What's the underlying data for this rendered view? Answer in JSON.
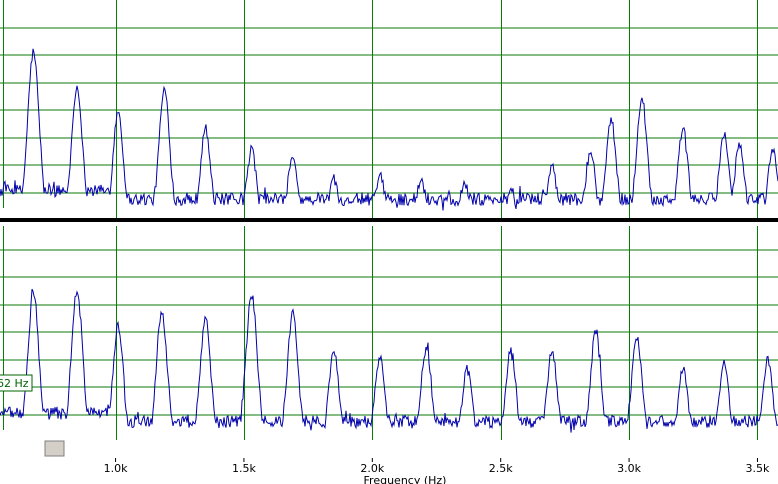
{
  "chart_data": {
    "type": "line",
    "xlabel": "Frequency (Hz)",
    "xlim": [
      550,
      3580
    ],
    "x_ticks": [
      {
        "value": 1000,
        "label": "1.0k"
      },
      {
        "value": 1500,
        "label": "1.5k"
      },
      {
        "value": 2000,
        "label": "2.0k"
      },
      {
        "value": 2500,
        "label": "2.5k"
      },
      {
        "value": 3000,
        "label": "3.0k"
      },
      {
        "value": 3500,
        "label": "3.5k"
      }
    ],
    "grid": true,
    "cursor_readout": "62 Hz",
    "panels": [
      {
        "id": "top",
        "ylim": [
          0,
          1
        ],
        "peaks": [
          {
            "x": 680,
            "y": 0.78
          },
          {
            "x": 850,
            "y": 0.62
          },
          {
            "x": 1010,
            "y": 0.5
          },
          {
            "x": 1190,
            "y": 0.6
          },
          {
            "x": 1350,
            "y": 0.42
          },
          {
            "x": 1530,
            "y": 0.32
          },
          {
            "x": 1690,
            "y": 0.28
          },
          {
            "x": 1850,
            "y": 0.18
          },
          {
            "x": 2030,
            "y": 0.19
          },
          {
            "x": 2190,
            "y": 0.17
          },
          {
            "x": 2360,
            "y": 0.16
          },
          {
            "x": 2540,
            "y": 0.13
          },
          {
            "x": 2700,
            "y": 0.24
          },
          {
            "x": 2850,
            "y": 0.31
          },
          {
            "x": 2930,
            "y": 0.46
          },
          {
            "x": 3050,
            "y": 0.56
          },
          {
            "x": 3210,
            "y": 0.42
          },
          {
            "x": 3370,
            "y": 0.4
          },
          {
            "x": 3430,
            "y": 0.35
          },
          {
            "x": 3560,
            "y": 0.32
          }
        ]
      },
      {
        "id": "bottom",
        "ylim": [
          0,
          1
        ],
        "peaks": [
          {
            "x": 680,
            "y": 0.7
          },
          {
            "x": 850,
            "y": 0.72
          },
          {
            "x": 1010,
            "y": 0.55
          },
          {
            "x": 1180,
            "y": 0.62
          },
          {
            "x": 1350,
            "y": 0.58
          },
          {
            "x": 1530,
            "y": 0.7
          },
          {
            "x": 1690,
            "y": 0.6
          },
          {
            "x": 1850,
            "y": 0.43
          },
          {
            "x": 2030,
            "y": 0.4
          },
          {
            "x": 2210,
            "y": 0.45
          },
          {
            "x": 2370,
            "y": 0.35
          },
          {
            "x": 2540,
            "y": 0.43
          },
          {
            "x": 2700,
            "y": 0.42
          },
          {
            "x": 2870,
            "y": 0.52
          },
          {
            "x": 3030,
            "y": 0.5
          },
          {
            "x": 3210,
            "y": 0.33
          },
          {
            "x": 3370,
            "y": 0.37
          },
          {
            "x": 3540,
            "y": 0.38
          }
        ]
      }
    ],
    "colors": {
      "trace": "#0000aa",
      "grid": "#0a7a0a",
      "panel_border": "#000000",
      "scrollbar": "#d4d0c8",
      "readout": "#006400"
    }
  }
}
